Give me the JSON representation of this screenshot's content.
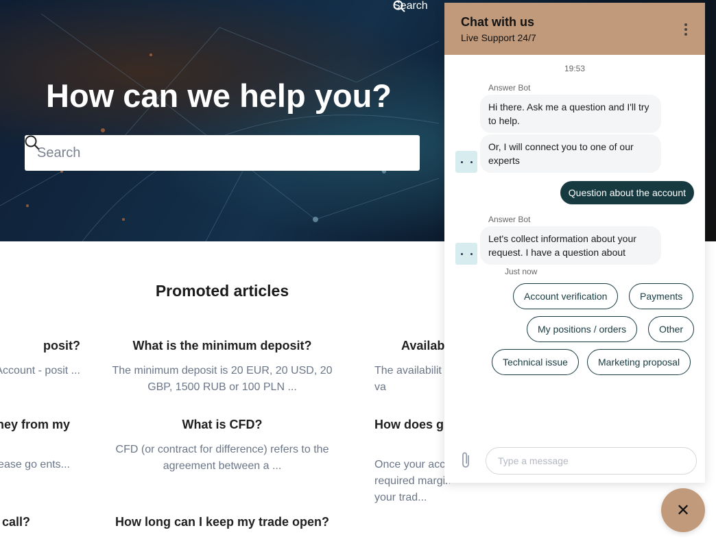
{
  "nav": {
    "search_label": "Search"
  },
  "hero": {
    "title": "How can we help you?",
    "search_placeholder": "Search"
  },
  "promoted": {
    "title": "Promoted articles",
    "articles": [
      {
        "title": "posit?",
        "snippet": "go to Account - posit ..."
      },
      {
        "title": "What is the minimum deposit?",
        "snippet": "The minimum deposit is 20 EUR, 20 USD, 20 GBP, 1500 RUB or 100 PLN ..."
      },
      {
        "title": "Availab",
        "snippet": "The availabilit may va"
      },
      {
        "title": "ney from my",
        "snippet": "App please go ents..."
      },
      {
        "title": "What is CFD?",
        "snippet": "CFD (or contract for difference) refers to the agreement between a ..."
      },
      {
        "title": "How does g",
        "snippet": "Once your acc required margin, your trad..."
      },
      {
        "title": "call?",
        "snippet": ""
      },
      {
        "title": "How long can I keep my trade open?",
        "snippet": ""
      }
    ]
  },
  "chat": {
    "title": "Chat with us",
    "subtitle": "Live Support 24/7",
    "time": "19:53",
    "bot_name": "Answer Bot",
    "messages": [
      "Hi there. Ask me a question and I'll try to help.",
      "Or, I will connect you to one of our experts"
    ],
    "user_message": "Question about the account",
    "message2": "Let's collect information about your request. I have a question about",
    "status": "Just now",
    "options": [
      "Account verification",
      "Payments",
      "My positions / orders",
      "Other",
      "Technical issue",
      "Marketing proposal"
    ],
    "input_placeholder": "Type a message",
    "colors": {
      "header": "#c09a7b",
      "accent": "#173a40"
    }
  }
}
